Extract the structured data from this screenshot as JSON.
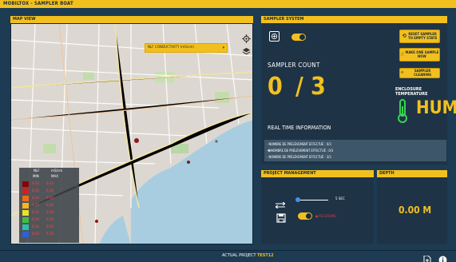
{
  "app": {
    "title": "MOBILTOX - SAMPLER BOAT"
  },
  "map_view": {
    "header": "MAP VIEW",
    "layer_select": {
      "value": "NLF CONDUCTIVITY (mS/cm)",
      "options": [
        "NLF CONDUCTIVITY (mS/cm)"
      ]
    },
    "legend": {
      "title": "NLF",
      "unit": "mS/cm",
      "min_header": "MIN",
      "max_header": "MAX",
      "rows": [
        {
          "color": "#8b0000",
          "min": "0.33",
          "max": "0.33"
        },
        {
          "color": "#d21f1f",
          "min": "0.33",
          "max": "0.33"
        },
        {
          "color": "#f06a1a",
          "min": "0.33",
          "max": "0.33"
        },
        {
          "color": "#f7b51e",
          "min": "0.33",
          "max": "0.33"
        },
        {
          "color": "#e8e22a",
          "min": "0.33",
          "max": "0.33"
        },
        {
          "color": "#3fbf3f",
          "min": "0.33",
          "max": "0.33"
        },
        {
          "color": "#2bbfb0",
          "min": "0.33",
          "max": "0.33"
        },
        {
          "color": "#2a62d8",
          "min": "0.33",
          "max": "0.33"
        }
      ]
    }
  },
  "sampler_system": {
    "header": "SAMPLER SYSTEM",
    "sampler_count_label": "SAMPLER COUNT",
    "sampler_count_current": "0",
    "sampler_count_sep": "/",
    "sampler_count_total": "3",
    "buttons": {
      "reset": "RESET SAMPLER\nTO EMPTY STATE",
      "make_sample": "MAKE ONE SAMPLE\nNOW",
      "cleaning": "SAMPLER CLEANING"
    },
    "enclosure_temp_label": "ENCLOSURE TEMPERATURE",
    "enclosure_temp_value": "HUM",
    "realtime_label": "REAL TIME INFORMATION",
    "realtime_lines": [
      "- NOMBRE DE PRÉLÈVEMENT EFFECTUÉ : 0/3",
      "-�NOMBRE DE PRÉLÈVEMENT EFFECTUÉ : 0/3",
      "- NOMBRE DE PRÉLÈVEMENT EFFECTUÉ : 3/3"
    ]
  },
  "project_management": {
    "header": "PROJECT MANAGEMENT",
    "interval_value": "5 SEC",
    "recording_label": "● RECORDING"
  },
  "depth": {
    "header": "DEPTH",
    "value": "0.00 M"
  },
  "status": {
    "project_label": "ACTUAL PROJECT",
    "project_name": "TEST12"
  },
  "colors": {
    "accent": "#f2c01e",
    "background": "#1d3b52",
    "panel": "#1f3346",
    "temp_icon": "#39d353",
    "recording": "#e8323c"
  }
}
